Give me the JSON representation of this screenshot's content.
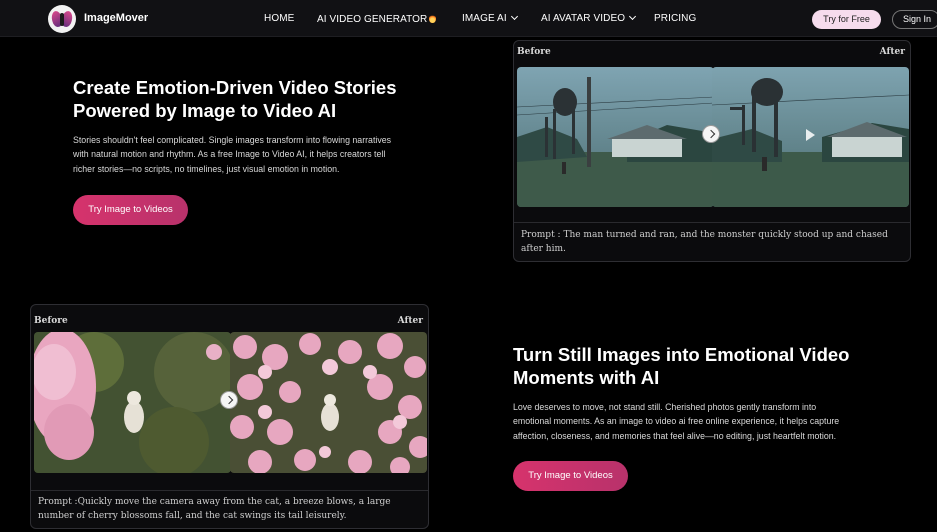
{
  "nav": {
    "brand": "ImageMover",
    "items": [
      "HOME",
      "AI VIDEO GENERATOR",
      "IMAGE AI",
      "AI AVATAR VIDEO",
      "PRICING"
    ],
    "try_label": "Try for Free",
    "signin_label": "Sign In"
  },
  "section1": {
    "title_line1": "Create Emotion-Driven Video Stories",
    "title_line2": "Powered by Image to Video AI",
    "body_line1": "Stories shouldn't feel complicated. Single images transform into flowing narratives",
    "body_line2": "with natural motion and rhythm. As a free Image to Video AI, it helps creators tell",
    "body_line3": "richer stories—no scripts, no timelines, just visual emotion in motion.",
    "cta": "Try Image to Videos",
    "demo": {
      "before": "Before",
      "after": "After",
      "prompt_line1": "Prompt : The man turned and ran, and the monster quickly stood up and chased",
      "prompt_line2": "after him."
    }
  },
  "section2": {
    "title_line1": "Turn Still Images into Emotional Video",
    "title_line2": "Moments with AI",
    "body_line1": "Love deserves to move, not stand still. Cherished photos gently transform into",
    "body_line2": "emotional moments. As an image to video ai free online experience, it helps capture",
    "body_line3": "affection, closeness, and memories that feel alive—no editing, just heartfelt motion.",
    "cta": "Try Image to Videos",
    "demo": {
      "before": "Before",
      "after": "After",
      "prompt_line1": "Prompt :Quickly move the camera away from the cat, a breeze blows, a large",
      "prompt_line2": "number of cherry blossoms fall, and the cat swings its tail leisurely."
    }
  },
  "colors": {
    "accent": "#d6336c",
    "bg": "#000000",
    "nav_bg": "#111114"
  },
  "icons": [
    "logo-icon",
    "fire-icon",
    "chevron-down-icon",
    "arrow-right-icon",
    "play-icon"
  ]
}
